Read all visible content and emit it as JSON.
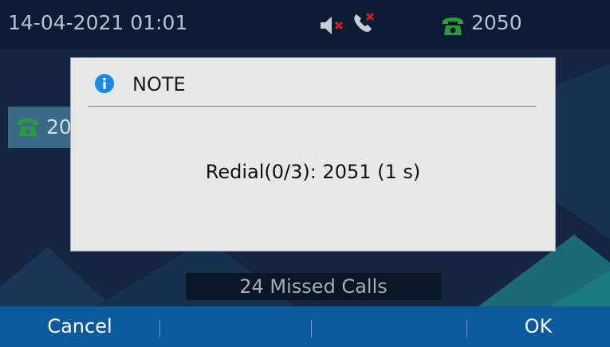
{
  "status_bar": {
    "datetime": "14-04-2021 01:01",
    "icons": [
      "mute-icon",
      "missed-call-icon",
      "phone-icon"
    ],
    "line_number": "2050"
  },
  "account_key": {
    "label": "20",
    "icon": "phone-icon"
  },
  "missed_calls": {
    "label": "24 Missed Calls"
  },
  "dialog": {
    "icon": "info-icon",
    "title": "NOTE",
    "message": "Redial(0/3): 2051 (1 s)"
  },
  "softkeys": {
    "left": "Cancel",
    "mid1": "",
    "mid2": "",
    "right": "OK"
  },
  "colors": {
    "background": "#13253f",
    "status_bar": "#0c1b33",
    "softkey_bar": "#0b5a9e",
    "dialog": "#e8e8e8",
    "line_icon_green": "#2a9b3a",
    "alert_red": "#d11e1e",
    "info_blue": "#1a8ae6"
  }
}
